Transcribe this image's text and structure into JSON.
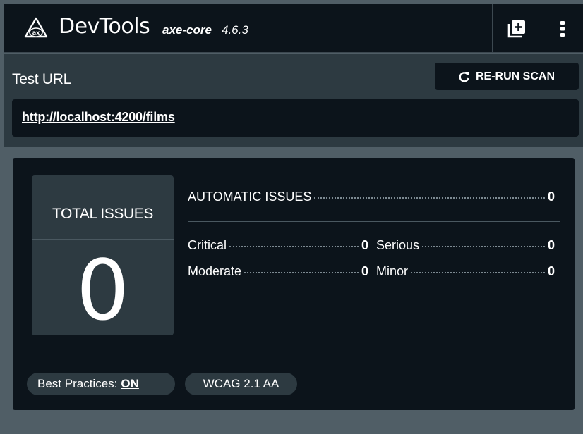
{
  "header": {
    "title": "DevTools",
    "engine": "axe-core",
    "version": "4.6.3",
    "logo_icon": "ax-logo-icon",
    "add_icon": "add-box-icon",
    "more_icon": "more-vertical-icon"
  },
  "test_url": {
    "label": "Test URL",
    "rerun_label": "RE-RUN SCAN",
    "rerun_icon": "refresh-icon",
    "url": "http://localhost:4200/films"
  },
  "results": {
    "total_label": "TOTAL ISSUES",
    "total_count": "0",
    "automatic_label": "AUTOMATIC ISSUES",
    "automatic_count": "0",
    "critical_label": "Critical",
    "critical_count": "0",
    "serious_label": "Serious",
    "serious_count": "0",
    "moderate_label": "Moderate",
    "moderate_count": "0",
    "minor_label": "Minor",
    "minor_count": "0"
  },
  "settings": {
    "best_practices_label": "Best Practices:",
    "best_practices_value": "ON",
    "standard": "WCAG 2.1 AA"
  },
  "colors": {
    "page_bg": "#505e66",
    "surface_dark": "#0c141b",
    "surface_mid": "#2d3a41",
    "text": "#ffffff"
  }
}
